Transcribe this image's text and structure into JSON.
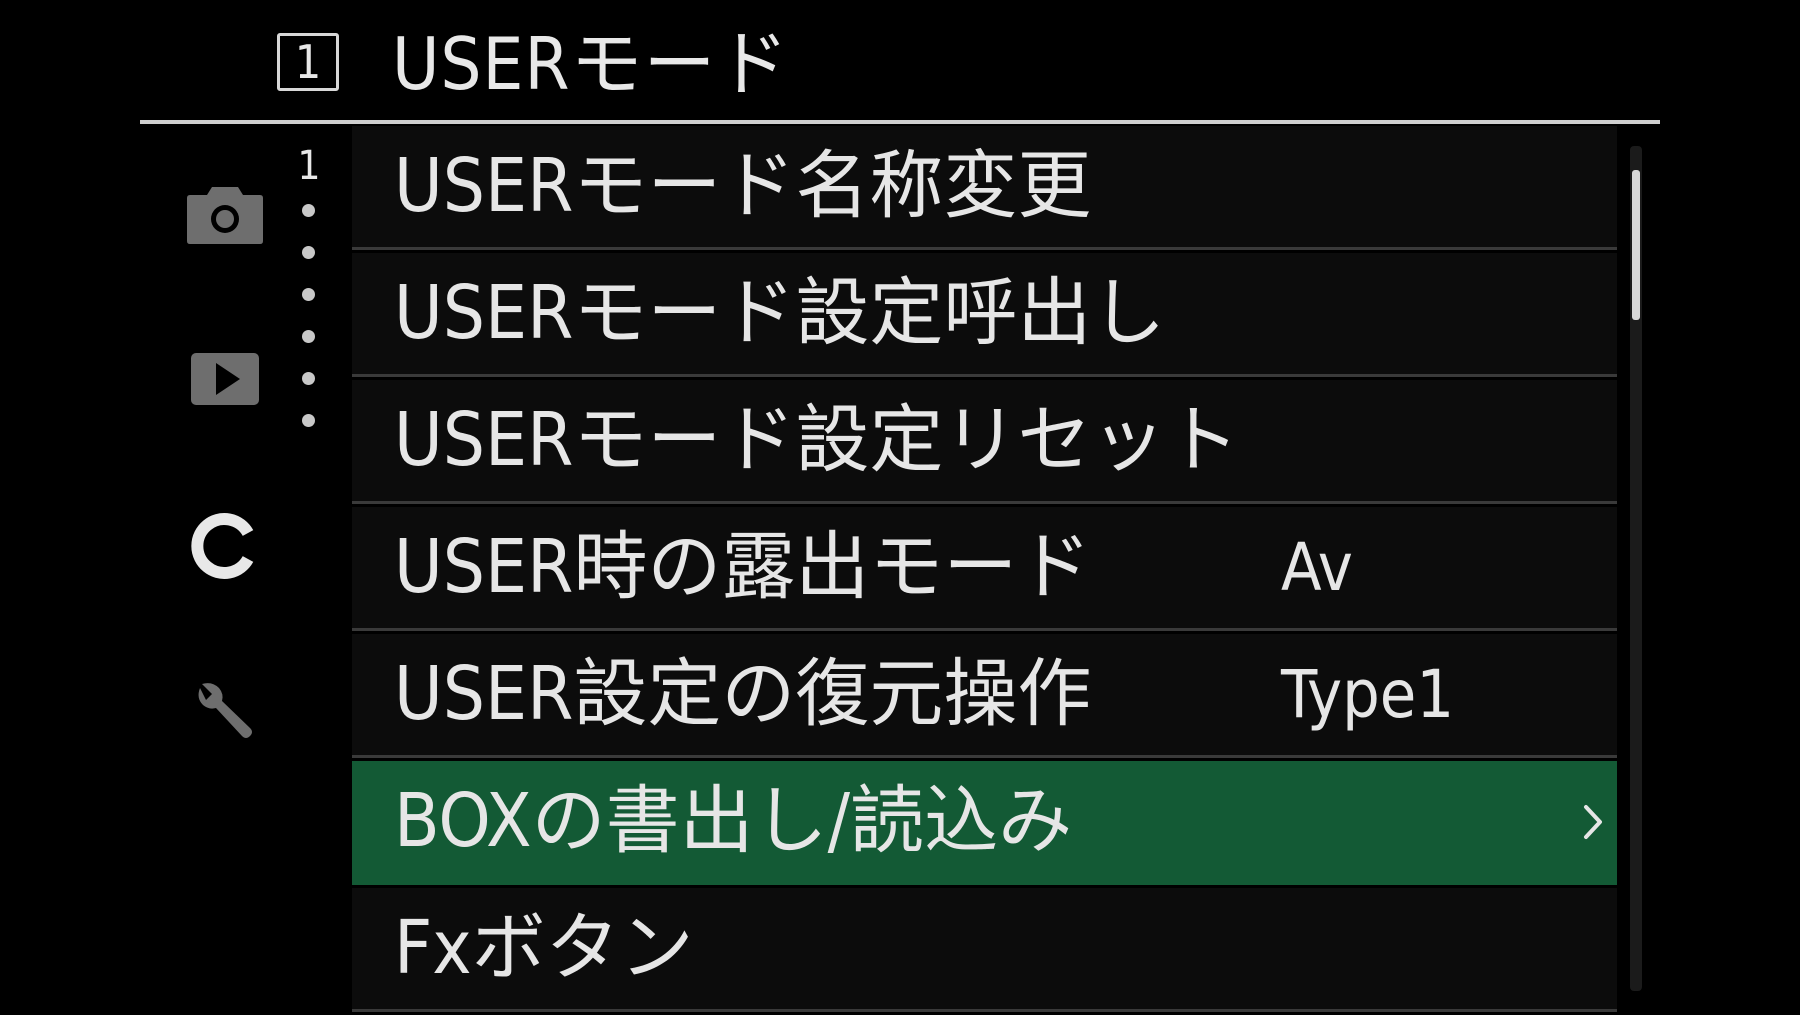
{
  "header": {
    "page_badge": "1",
    "title": "USERモード"
  },
  "sidebar": {
    "page_number": "1",
    "items": [
      {
        "icon": "camera-icon",
        "state": "inactive"
      },
      {
        "icon": "playback-icon",
        "state": "inactive"
      },
      {
        "icon": "custom-c-icon",
        "state": "active"
      },
      {
        "icon": "wrench-icon",
        "state": "inactive"
      }
    ]
  },
  "menu": {
    "items": [
      {
        "label": "USERモード名称変更",
        "value": ""
      },
      {
        "label": "USERモード設定呼出し",
        "value": ""
      },
      {
        "label": "USERモード設定リセット",
        "value": ""
      },
      {
        "label": "USER時の露出モード",
        "value": "Av"
      },
      {
        "label": "USER設定の復元操作",
        "value": "Type1"
      },
      {
        "label": "BOXの書出し/読込み",
        "value": "",
        "selected": true,
        "has_submenu": true
      },
      {
        "label": "Fxボタン",
        "value": ""
      }
    ]
  },
  "colors": {
    "background": "#000000",
    "row_background": "#0c0c0c",
    "selected_row": "#135a35",
    "text": "#e6e6e6",
    "divider": "#3a3a3a"
  }
}
